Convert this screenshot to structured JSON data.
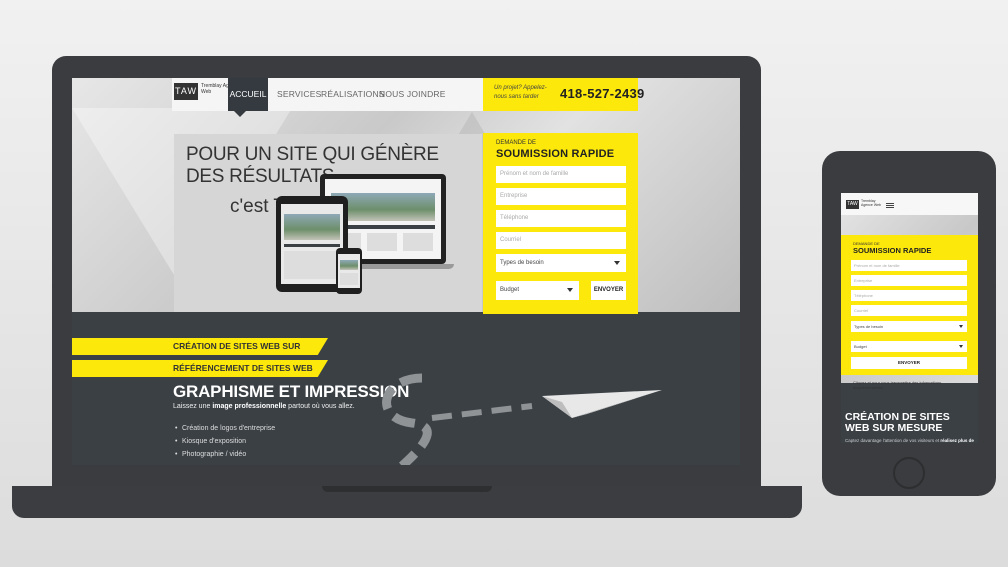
{
  "site": {
    "logo_mark": "TAW",
    "logo_text": "Tremblay Agence Web",
    "nav": [
      "ACCUEIL",
      "SERVICES",
      "RÉALISATIONS",
      "NOUS JOINDRE"
    ],
    "cta_text": "Un projet? Appelez-nous sans tarder",
    "phone": "418-527-2439",
    "headline": "POUR UN SITE QUI GÉNÈRE DES RÉSULTATS,",
    "subline": "c'est TAW!",
    "form": {
      "label_small": "DEMANDE DE",
      "label_big": "SOUMISSION RAPIDE",
      "fields": [
        "Prénom et nom de famille",
        "Entreprise",
        "Téléphone",
        "Courriel"
      ],
      "need_select": "Types de besoin",
      "budget_select": "Budget",
      "submit": "ENVOYER"
    },
    "services": {
      "ribbon_1": "CRÉATION DE SITES WEB SUR MESURE",
      "ribbon_2": "RÉFÉRENCEMENT DE SITES WEB",
      "title": "GRAPHISME ET IMPRESSION",
      "subtitle_pre": "Laissez une ",
      "subtitle_bold": "image professionnelle",
      "subtitle_post": " partout où vous allez.",
      "bullets": [
        "Création de logos d'entreprise",
        "Kiosque d'exposition",
        "Photographie / vidéo"
      ]
    }
  },
  "mobile": {
    "logo_mark": "TAW",
    "logo_text": "Tremblay Agence Web",
    "form": {
      "label_small": "DEMANDE DE",
      "label_big": "SOUMISSION RAPIDE",
      "fields": [
        "Prénom et nom de famille",
        "Entreprise",
        "Téléphone",
        "Courriel"
      ],
      "need_select": "Types de besoin",
      "budget_select": "Budget",
      "submit": "ENVOYER",
      "note": "Cliquez et pour vous transmettre des informations supplémentaires"
    },
    "title": "CRÉATION DE SITES WEB SUR MESURE",
    "desc_pre": "Captez davantage l'attention de vos visiteurs et ",
    "desc_bold": "réalisez plus de"
  },
  "colors": {
    "accent": "#fce80a",
    "dark": "#3b4045",
    "device": "#3b3c3f"
  }
}
